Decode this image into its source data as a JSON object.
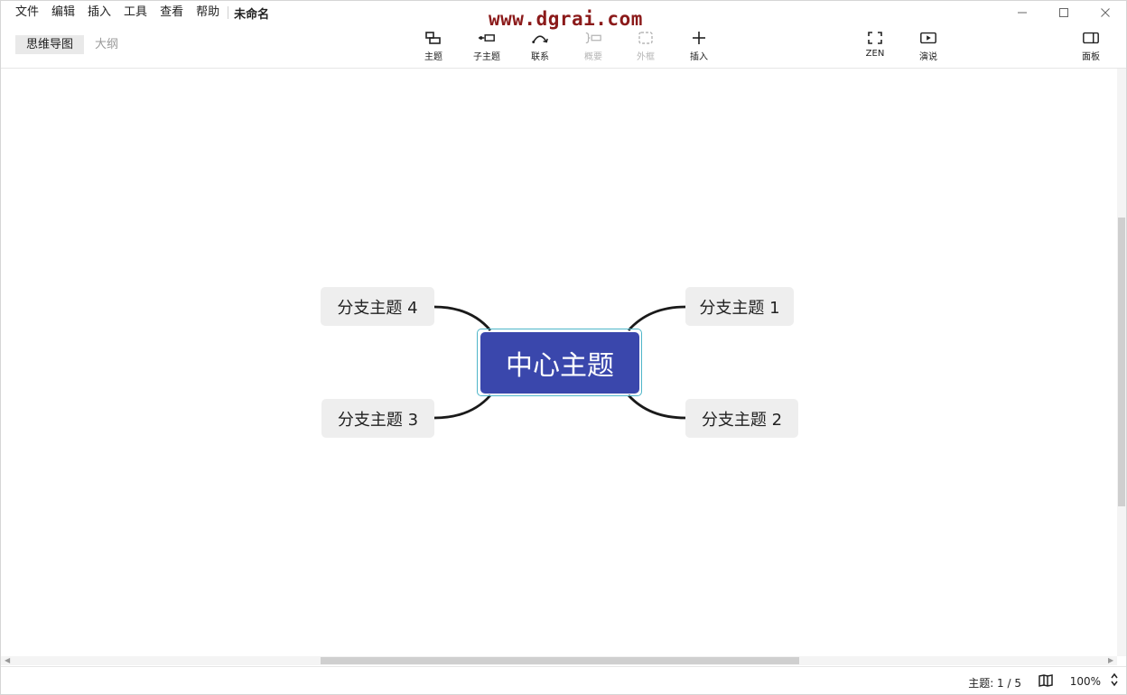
{
  "menu": {
    "items": [
      "文件",
      "编辑",
      "插入",
      "工具",
      "查看",
      "帮助"
    ],
    "doc_title": "未命名"
  },
  "watermark": "www.dgrai.com",
  "view_switch": {
    "mindmap": "思维导图",
    "outline": "大纲"
  },
  "toolbar": {
    "topic": "主题",
    "subtopic": "子主题",
    "relationship": "联系",
    "summary": "概要",
    "boundary": "外框",
    "insert": "插入",
    "zen": "ZEN",
    "present": "演说",
    "panel": "面板"
  },
  "mindmap": {
    "central": "中心主题",
    "branches": [
      "分支主题 1",
      "分支主题 2",
      "分支主题 3",
      "分支主题 4"
    ]
  },
  "status": {
    "topic_count": "主题: 1 / 5",
    "zoom": "100%"
  },
  "colors": {
    "central_fill": "#3a47ac",
    "selection_outline": "#4fb6c9",
    "branch_fill": "#eeeeee",
    "watermark": "#8b1a1a"
  }
}
